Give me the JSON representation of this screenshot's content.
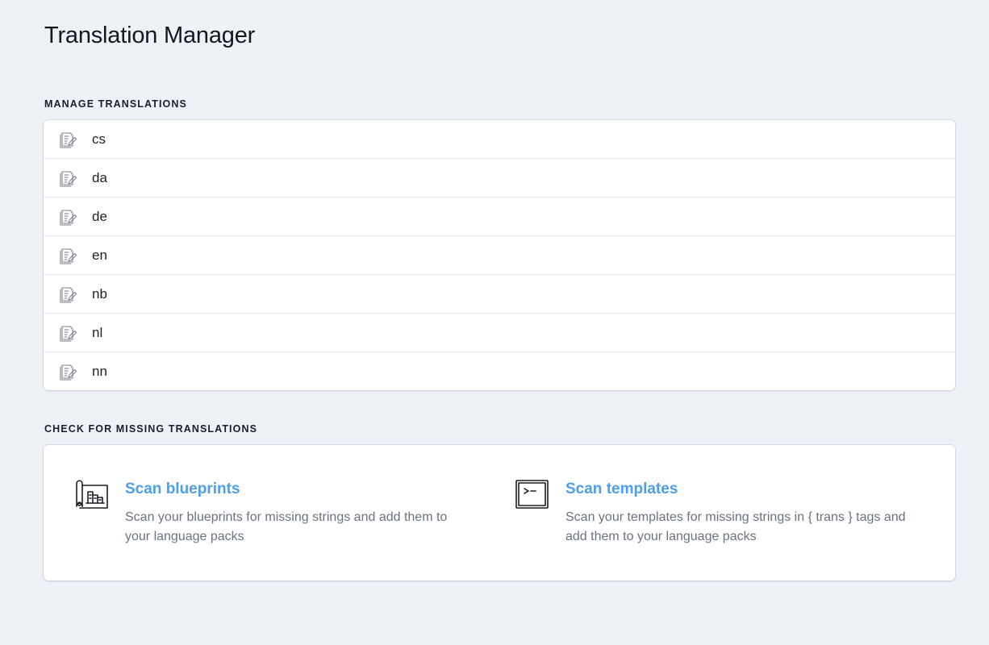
{
  "page": {
    "title": "Translation Manager"
  },
  "manage": {
    "heading": "Manage Translations",
    "languages": [
      {
        "code": "cs",
        "icon": "document-edit-icon"
      },
      {
        "code": "da",
        "icon": "document-edit-icon"
      },
      {
        "code": "de",
        "icon": "document-edit-icon"
      },
      {
        "code": "en",
        "icon": "document-edit-icon"
      },
      {
        "code": "nb",
        "icon": "document-edit-icon"
      },
      {
        "code": "nl",
        "icon": "document-edit-icon"
      },
      {
        "code": "nn",
        "icon": "document-edit-icon"
      }
    ]
  },
  "missing": {
    "heading": "Check for missing translations",
    "blueprints": {
      "title": "Scan blueprints",
      "description": "Scan your blueprints for missing strings and add them to your language packs",
      "icon": "blueprint-scroll-icon"
    },
    "templates": {
      "title": "Scan templates",
      "description": "Scan your templates for missing strings in { trans } tags and add them to your language packs",
      "icon": "terminal-icon"
    }
  },
  "colors": {
    "accent": "#4f9ee8",
    "background": "#eef2f7",
    "card": "#ffffff",
    "muted_text": "#6b7380"
  }
}
